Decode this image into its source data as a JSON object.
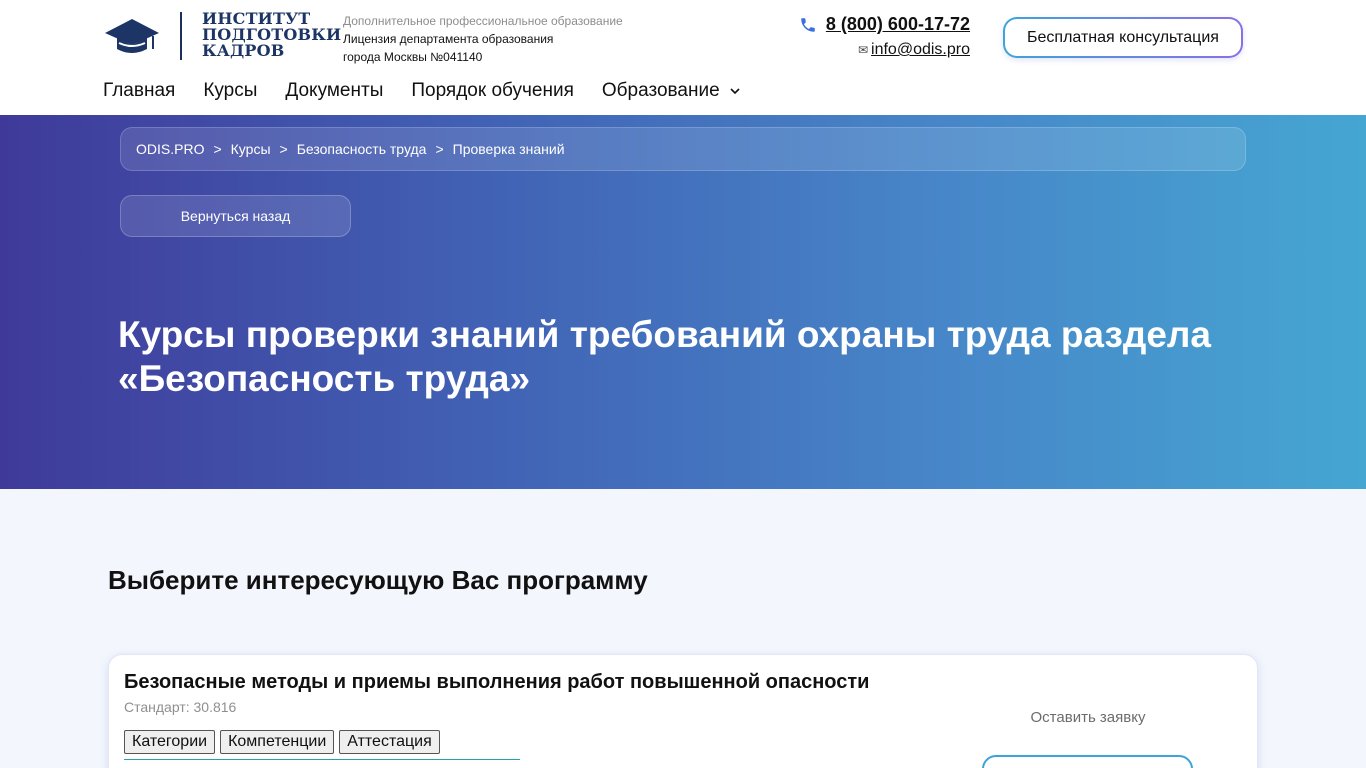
{
  "header": {
    "logo": {
      "line1": "ИНСТИТУТ",
      "line2": "ПОДГОТОВКИ",
      "line3": "КАДРОВ"
    },
    "license": {
      "line1": "Дополнительное профессиональное образование",
      "line2": "Лицензия департамента образования",
      "line3": "города Москвы №041140"
    },
    "phone": "8 (800) 600-17-72",
    "email_icon": "✉",
    "email": "info@odis.pro",
    "consult_button": "Бесплатная консультация",
    "accent_colors": {
      "navy": "#1d3566",
      "gradient_start": "#3fa3d9",
      "gradient_end": "#8a6fe8",
      "phone_icon": "#3a6fe0"
    }
  },
  "nav": {
    "items": [
      {
        "label": "Главная"
      },
      {
        "label": "Курсы"
      },
      {
        "label": "Документы"
      },
      {
        "label": "Порядок обучения"
      },
      {
        "label": "Образование",
        "has_dropdown": true
      }
    ]
  },
  "hero": {
    "breadcrumb": {
      "items": [
        "ODIS.PRO",
        "Курсы",
        "Безопасность труда"
      ],
      "current": "Проверка знаний",
      "separator": ">"
    },
    "back_button": "Вернуться назад",
    "title": "Курсы проверки знаний требований охраны труда раздела «Безопасность труда»",
    "gradient": {
      "start": "#3f3a9a",
      "end": "#45a6d2"
    }
  },
  "main": {
    "section_title": "Выберите интересующую Вас программу",
    "card": {
      "title": "Безопасные методы и приемы выполнения работ повышенной опасности",
      "standard": "Стандарт: 30.816",
      "tabs": [
        "Категории",
        "Компетенции",
        "Аттестация"
      ],
      "apply_label": "Оставить заявку"
    }
  }
}
